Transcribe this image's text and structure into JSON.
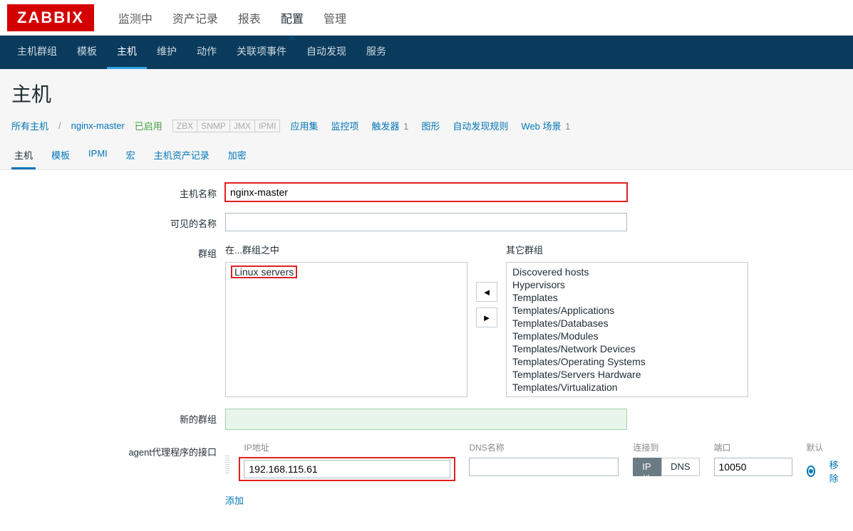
{
  "logo": "ZABBIX",
  "topnav": {
    "items": [
      "监测中",
      "资产记录",
      "报表",
      "配置",
      "管理"
    ],
    "active_index": 3
  },
  "subnav": {
    "items": [
      "主机群组",
      "模板",
      "主机",
      "维护",
      "动作",
      "关联项事件",
      "自动发现",
      "服务"
    ],
    "active_index": 2
  },
  "page_title": "主机",
  "breadcrumb": {
    "all_hosts": "所有主机",
    "host_name": "nginx-master",
    "enabled": "已启用",
    "protocols": [
      "ZBX",
      "SNMP",
      "JMX",
      "IPMI"
    ]
  },
  "context_links": [
    {
      "label": "应用集",
      "count": ""
    },
    {
      "label": "监控项",
      "count": ""
    },
    {
      "label": "触发器",
      "count": "1"
    },
    {
      "label": "图形",
      "count": ""
    },
    {
      "label": "自动发现规则",
      "count": ""
    },
    {
      "label": "Web 场景",
      "count": "1"
    }
  ],
  "inner_tabs": {
    "items": [
      "主机",
      "模板",
      "IPMI",
      "宏",
      "主机资产记录",
      "加密"
    ],
    "active_index": 0
  },
  "form": {
    "hostname_label": "主机名称",
    "hostname_value": "nginx-master",
    "visible_name_label": "可见的名称",
    "visible_name_value": "",
    "groups_label": "群组",
    "in_groups_label": "在...群组之中",
    "other_groups_label": "其它群组",
    "in_groups": [
      "Linux servers"
    ],
    "other_groups": [
      "Discovered hosts",
      "Hypervisors",
      "Templates",
      "Templates/Applications",
      "Templates/Databases",
      "Templates/Modules",
      "Templates/Network Devices",
      "Templates/Operating Systems",
      "Templates/Servers Hardware",
      "Templates/Virtualization"
    ],
    "new_group_label": "新的群组",
    "new_group_value": "",
    "iface_label": "agent代理程序的接口",
    "iface_ip_label": "IP地址",
    "iface_ip_value": "192.168.115.61",
    "iface_dns_label": "DNS名称",
    "iface_dns_value": "",
    "iface_connect_label": "连接到",
    "iface_connect_ip": "IP地址",
    "iface_connect_dns": "DNS",
    "iface_port_label": "端口",
    "iface_port_value": "10050",
    "iface_default_label": "默认",
    "iface_remove": "移除",
    "iface_add": "添加"
  }
}
